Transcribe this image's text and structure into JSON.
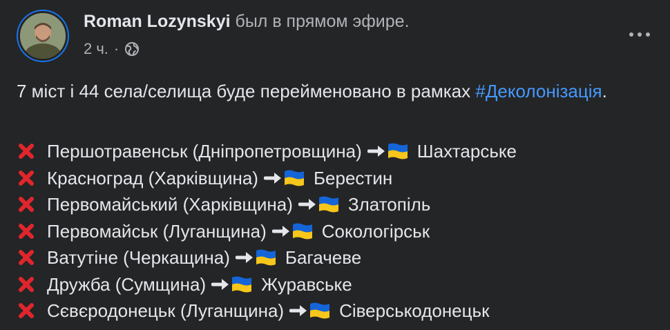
{
  "post": {
    "author_name": "Roman Lozynskyi",
    "author_action": " был в прямом эфире.",
    "time": "2 ч.",
    "dot": "·",
    "privacy_icon": "globe-icon",
    "more_icon": "more-options-icon",
    "intro_text": "7 міст і 44 села/селища буде перейменовано в рамках ",
    "hashtag": "#Деколонізація",
    "intro_end": ".",
    "cities": [
      {
        "old": "Першотравенськ (Дніпропетровщина) ",
        "new": "Шахтарське"
      },
      {
        "old": "Красноград (Харківщина) ",
        "new": "Берестин"
      },
      {
        "old": "Первомайський (Харківщина) ",
        "new": "Златопіль"
      },
      {
        "old": "Первомайськ (Луганщина) ",
        "new": "Сокологірськ"
      },
      {
        "old": "Ватутіне (Черкащина) ",
        "new": "Багачеве"
      },
      {
        "old": "Дружба (Сумщина) ",
        "new": "Журавське"
      },
      {
        "old": "Сєвєродонецьк (Луганщина) ",
        "new": "Сіверськодонецьк"
      }
    ]
  },
  "colors": {
    "background": "#242526",
    "primary_text": "#e4e6eb",
    "secondary_text": "#b0b3b8",
    "link": "#4599ff",
    "cross": "#e0262c",
    "flag_blue": "#1565d8",
    "flag_yellow": "#f7c61b"
  }
}
